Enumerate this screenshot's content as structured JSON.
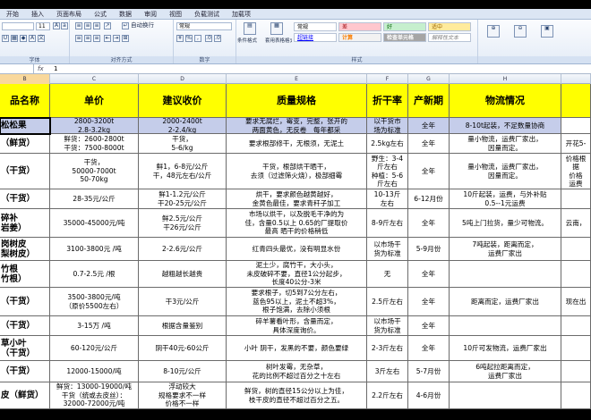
{
  "ribbon": {
    "tabs": [
      "开始",
      "插入",
      "页面布局",
      "公式",
      "数据",
      "审阅",
      "视图",
      "负载测试",
      "加载项"
    ],
    "font_size": "11",
    "wrap_text": "自动换行",
    "number_format": "常规",
    "cond_format": "条件格式",
    "table_format": "套用表格格式",
    "styles": [
      {
        "label": "常规",
        "bg": "#ffffff",
        "fg": "#000000"
      },
      {
        "label": "差",
        "bg": "#ffc7ce",
        "fg": "#9c0006"
      },
      {
        "label": "好",
        "bg": "#c6efce",
        "fg": "#006100"
      },
      {
        "label": "适中",
        "bg": "#ffeb9c",
        "fg": "#9c6500"
      },
      {
        "label": "超链接",
        "bg": "#ffffff",
        "fg": "#0000ff"
      },
      {
        "label": "计算",
        "bg": "#f2f2f2",
        "fg": "#fa7d00"
      },
      {
        "label": "检查单元格",
        "bg": "#a5a5a5",
        "fg": "#ffffff"
      },
      {
        "label": "解释性文本",
        "bg": "#ffffff",
        "fg": "#7f7f7f"
      }
    ],
    "group_labels": {
      "clipboard": "",
      "font": "字体",
      "alignment": "对齐方式",
      "number": "数字",
      "styles": "样式",
      "cells": ""
    }
  },
  "formula_bar": {
    "name_box": "",
    "fx": "fx",
    "value": "1"
  },
  "column_headers": [
    "B",
    "C",
    "D",
    "E",
    "F",
    "G",
    "H",
    ""
  ],
  "table": {
    "headers": [
      "品名称",
      "单价",
      "建议收价",
      "质量规格",
      "折干率",
      "产新期",
      "物流情况",
      ""
    ],
    "rows": [
      [
        "松松果",
        "2800-3200t\n2.8-3.2kg",
        "2000-2400t\n2-2.4/kg",
        "要求无腐烂，霉变，完整，张开的\n两面黄色，无反卷　每年都采",
        "以干货市\n场为标准",
        "全年",
        "8-10t起装，不足数量协商",
        ""
      ],
      [
        "（鲜货）",
        "鲜货：2600-2800t\n干货：7500-8000t",
        "干货，\n5-6/kg",
        "要求根部修干，无根须，无泥土",
        "2.5kg左右",
        "全年",
        "量小物流，运费厂家出，\n因量而定。",
        "开花5-"
      ],
      [
        "（干货）",
        "干货，\n50000-7000t\n50-70kg",
        "鲜1，6-8元/公斤\n干，48元左右/公斤",
        "干货，根部烘干晒干，\n去须（过滤筛火烧），极部细霉",
        "野生：3-4\n斤左右\n种植：5-6\n斤左右",
        "全年",
        "量小物流，运费厂家出，\n因量而定。",
        "价格根据\n价格\n运费"
      ],
      [
        "（干货）",
        "28-35元/公斤",
        "鲜1-1.2元/公斤\n干20-25元/公斤",
        "烘干，要求颜色越黄越好，\n金黄色最佳，要求青秆子加工",
        "10-13斤\n左右",
        "6-12月份",
        "10斤起装，运费，与外补贴\n0.5--1元运费",
        ""
      ],
      [
        "碎补\n岩姜）",
        "35000-45000元/吨",
        "鲜2.5元/公斤\n干26元/公斤",
        "市场以烘干，以及脱毛干净的为\n佳，含量0.5以上 0.65的厂提取价\n最高 晒干的价格稍低",
        "8-9斤左右",
        "全年",
        "5吨上门拉货，量少可物流。",
        "云南，"
      ],
      [
        "岗树皮\n梨树皮）",
        "3100-3800元 /吨",
        "2-2.6元/公斤",
        "红青四头最优，没有明显水份",
        "以市场干\n货为标准",
        "5-9月份",
        "7吨起装，距离而定，\n运费厂家出",
        ""
      ],
      [
        "竹根\n竹根）",
        "0.7-2.5元 /根",
        "越粗越长越贵",
        "泥土少，腐竹干，大小头，\n未皮破碎不要，直径1公分起步，\n长度40公分-3米",
        "无",
        "全年",
        "",
        ""
      ],
      [
        "（干货）",
        "3500-3800元/吨\n（原价5500左右）",
        "干3元/公斤",
        "要求根子，切5到7公分左右，\n蓝色95以上，泥土不超3%，\n根子饱满，去除小须根",
        "2.5斤左右",
        "全年",
        "距离而定，运费厂家出",
        "现在出"
      ],
      [
        "（干货）",
        "3-15万 /吨",
        "根据含量鉴别",
        "碎羊薯看叶形，含量而定，\n具体深度询价。",
        "以市场干\n货为标准",
        "全年",
        "",
        ""
      ],
      [
        "草小叶\n（干货）",
        "60-120元/公斤",
        "阴干40元-60公斤",
        "小叶 阴干，发黑的不要，颜色要绿",
        "2-3斤左右",
        "全年",
        "10斤可发物流，运费厂家出",
        ""
      ],
      [
        "（干货）",
        "12000-15000/吨",
        "8-10元/公斤",
        "树叶发霉，无杂草，\n花的比例不超过百分之十左右",
        "3斤左右",
        "5-7月份",
        "6吨起拉距离而定，\n运费厂家出",
        ""
      ],
      [
        "皮（鲜货）",
        "鲜货：13000-19000/吨\n干货（统或去皮丝）：\n32000-72000元/吨",
        "浮动较大\n规格要求不一样\n价格不一样",
        "鲜货，树的直径15公分以上为佳，\n枝干皮的直径不超过百分之五。",
        "2.2斤左右",
        "4-6月份",
        "",
        ""
      ]
    ]
  }
}
